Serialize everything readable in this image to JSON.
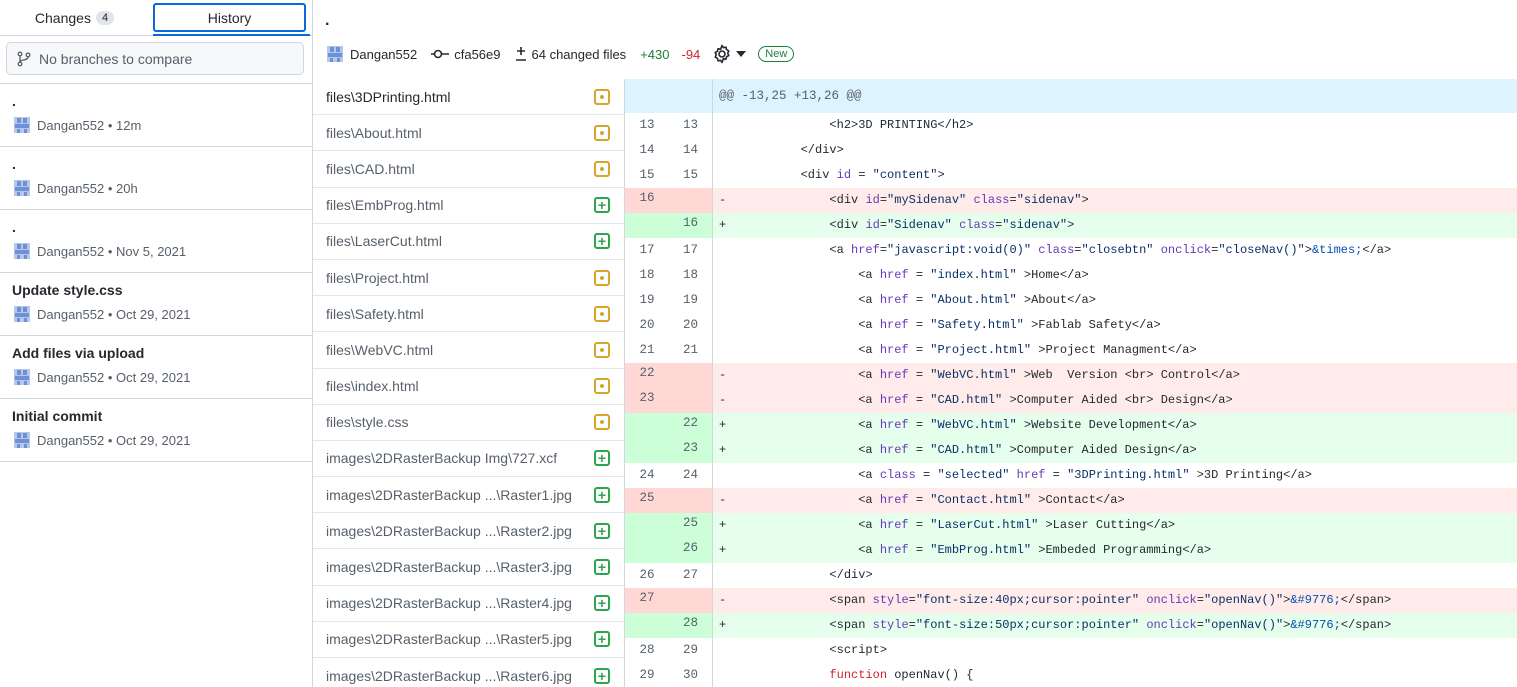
{
  "sidebar": {
    "tabs": [
      {
        "label": "Changes",
        "count": "4"
      },
      {
        "label": "History"
      }
    ],
    "branch_compare_placeholder": "No branches to compare",
    "commits": [
      {
        "summary": ".",
        "author": "Dangan552",
        "time": "12m"
      },
      {
        "summary": ".",
        "author": "Dangan552",
        "time": "20h"
      },
      {
        "summary": ".",
        "author": "Dangan552",
        "time": "Nov 5, 2021"
      },
      {
        "summary": "Update style.css",
        "author": "Dangan552",
        "time": "Oct 29, 2021"
      },
      {
        "summary": "Add files via upload",
        "author": "Dangan552",
        "time": "Oct 29, 2021"
      },
      {
        "summary": "Initial commit",
        "author": "Dangan552",
        "time": "Oct 29, 2021"
      }
    ]
  },
  "commit": {
    "title": ".",
    "author": "Dangan552",
    "sha": "cfa56e9",
    "changed_files": "64 changed files",
    "additions": "+430",
    "deletions": "-94",
    "new_badge": "New"
  },
  "files": [
    {
      "name": "files\\3DPrinting.html",
      "status": "modified"
    },
    {
      "name": "files\\About.html",
      "status": "modified"
    },
    {
      "name": "files\\CAD.html",
      "status": "modified"
    },
    {
      "name": "files\\EmbProg.html",
      "status": "added"
    },
    {
      "name": "files\\LaserCut.html",
      "status": "added"
    },
    {
      "name": "files\\Project.html",
      "status": "modified"
    },
    {
      "name": "files\\Safety.html",
      "status": "modified"
    },
    {
      "name": "files\\WebVC.html",
      "status": "modified"
    },
    {
      "name": "files\\index.html",
      "status": "modified"
    },
    {
      "name": "files\\style.css",
      "status": "modified"
    },
    {
      "name": "images\\2DRasterBackup Img\\727.xcf",
      "status": "added"
    },
    {
      "name": "images\\2DRasterBackup ...\\Raster1.jpg",
      "status": "added"
    },
    {
      "name": "images\\2DRasterBackup ...\\Raster2.jpg",
      "status": "added"
    },
    {
      "name": "images\\2DRasterBackup ...\\Raster3.jpg",
      "status": "added"
    },
    {
      "name": "images\\2DRasterBackup ...\\Raster4.jpg",
      "status": "added"
    },
    {
      "name": "images\\2DRasterBackup ...\\Raster5.jpg",
      "status": "added"
    },
    {
      "name": "images\\2DRasterBackup ...\\Raster6.jpg",
      "status": "added"
    }
  ],
  "diff": {
    "hunk_header": "@@ -13,25 +13,26 @@",
    "lines": [
      {
        "type": "ctx",
        "old": "13",
        "new": "13",
        "code": "            <h2>3D PRINTING</h2>"
      },
      {
        "type": "ctx",
        "old": "14",
        "new": "14",
        "code": "        </div>"
      },
      {
        "type": "ctx",
        "old": "15",
        "new": "15",
        "code": "        <div id = \"content\">"
      },
      {
        "type": "del",
        "old": "16",
        "new": "",
        "code": "            <div id=\"mySidenav\" class=\"sidenav\">"
      },
      {
        "type": "add",
        "old": "",
        "new": "16",
        "code": "            <div id=\"Sidenav\" class=\"sidenav\">"
      },
      {
        "type": "ctx",
        "old": "17",
        "new": "17",
        "code": "            <a href=\"javascript:void(0)\" class=\"closebtn\" onclick=\"closeNav()\">&times;</a>"
      },
      {
        "type": "ctx",
        "old": "18",
        "new": "18",
        "code": "                <a href = \"index.html\" >Home</a>"
      },
      {
        "type": "ctx",
        "old": "19",
        "new": "19",
        "code": "                <a href = \"About.html\" >About</a>"
      },
      {
        "type": "ctx",
        "old": "20",
        "new": "20",
        "code": "                <a href = \"Safety.html\" >Fablab Safety</a>"
      },
      {
        "type": "ctx",
        "old": "21",
        "new": "21",
        "code": "                <a href = \"Project.html\" >Project Managment</a>"
      },
      {
        "type": "del",
        "old": "22",
        "new": "",
        "code": "                <a href = \"WebVC.html\" >Web & Version <br> Control</a>"
      },
      {
        "type": "del",
        "old": "23",
        "new": "",
        "code": "                <a href = \"CAD.html\" >Computer Aided <br> Design</a>"
      },
      {
        "type": "add",
        "old": "",
        "new": "22",
        "code": "                <a href = \"WebVC.html\" >Website Development</a>"
      },
      {
        "type": "add",
        "old": "",
        "new": "23",
        "code": "                <a href = \"CAD.html\" >Computer Aided Design</a>"
      },
      {
        "type": "ctx",
        "old": "24",
        "new": "24",
        "code": "                <a class = \"selected\" href = \"3DPrinting.html\" >3D Printing</a>"
      },
      {
        "type": "del",
        "old": "25",
        "new": "",
        "code": "                <a href = \"Contact.html\" >Contact</a>"
      },
      {
        "type": "add",
        "old": "",
        "new": "25",
        "code": "                <a href = \"LaserCut.html\" >Laser Cutting</a>"
      },
      {
        "type": "add",
        "old": "",
        "new": "26",
        "code": "                <a href = \"EmbProg.html\" >Embeded Programming</a>"
      },
      {
        "type": "ctx",
        "old": "26",
        "new": "27",
        "code": "            </div>"
      },
      {
        "type": "del",
        "old": "27",
        "new": "",
        "code": "            <span style=\"font-size:40px;cursor:pointer\" onclick=\"openNav()\">&#9776;</span>"
      },
      {
        "type": "add",
        "old": "",
        "new": "28",
        "code": "            <span style=\"font-size:50px;cursor:pointer\" onclick=\"openNav()\">&#9776;</span>"
      },
      {
        "type": "ctx",
        "old": "28",
        "new": "29",
        "code": "            <script>"
      },
      {
        "type": "ctx",
        "old": "29",
        "new": "30",
        "code": "            function openNav() {"
      }
    ]
  }
}
